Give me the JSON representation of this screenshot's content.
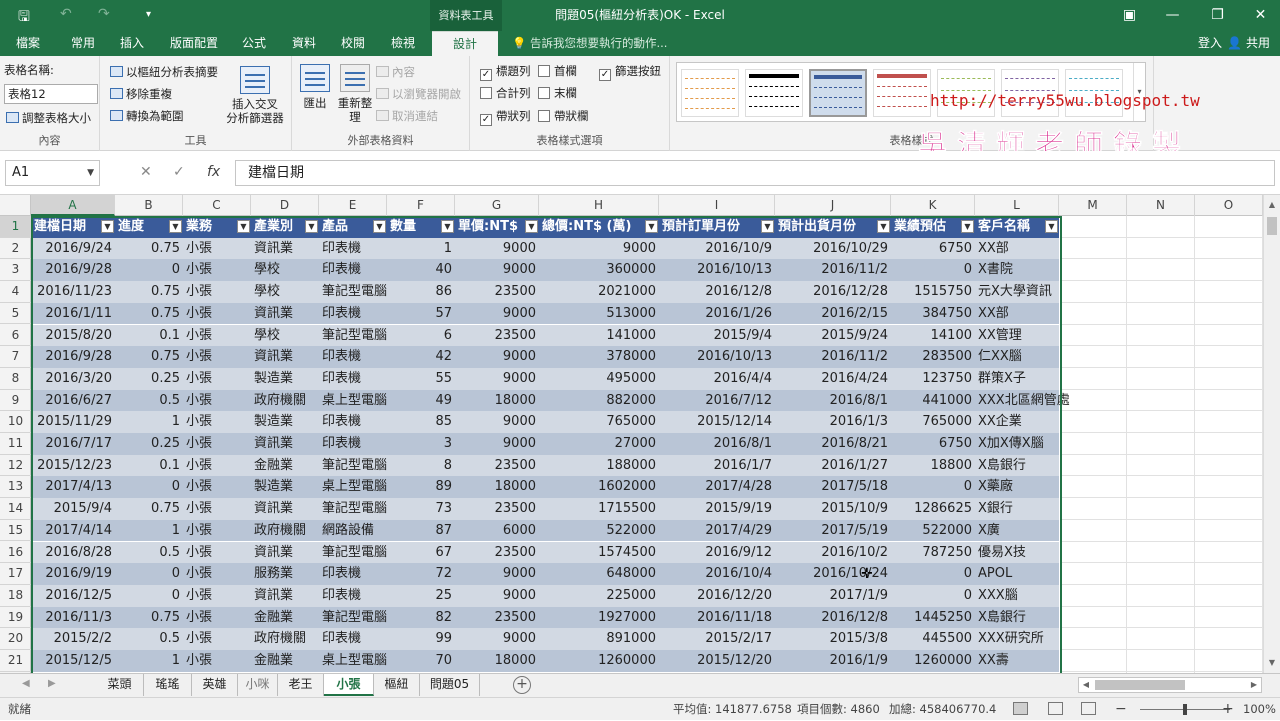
{
  "titlebar": {
    "context_tab": "資料表工具",
    "doc_title": "問題05(樞紐分析表)OK - Excel"
  },
  "tabs": [
    "檔案",
    "常用",
    "插入",
    "版面配置",
    "公式",
    "資料",
    "校閱",
    "檢視",
    "設計"
  ],
  "tell_me": "告訴我您想要執行的動作...",
  "sign_in": "登入",
  "share": "共用",
  "ribbon": {
    "props": {
      "label": "表格名稱:",
      "name": "表格12",
      "resize": "調整表格大小",
      "group": "內容"
    },
    "tools": {
      "pivot": "以樞紐分析表摘要",
      "dedupe": "移除重複",
      "to_range": "轉換為範圍",
      "slicer_line1": "插入交叉",
      "slicer_line2": "分析篩選器",
      "group": "工具"
    },
    "external": {
      "export": "匯出",
      "refresh_line1": "重新整",
      "refresh_line2": "理",
      "properties": "內容",
      "open_browser": "以瀏覽器開啟",
      "unlink": "取消連結",
      "group": "外部表格資料"
    },
    "options": {
      "header_row": "標題列",
      "first_col": "首欄",
      "filter_btn": "篩選按鈕",
      "total_row": "合計列",
      "last_col": "末欄",
      "banded_rows": "帶狀列",
      "banded_cols": "帶狀欄",
      "group": "表格樣式選項"
    },
    "styles_group": "表格樣式"
  },
  "watermark": {
    "url": "http://terry55wu.blogspot.tw",
    "title": "吳清輝老師錄製"
  },
  "formula_bar": {
    "name_box": "A1",
    "cancel": "✕",
    "enter": "✓",
    "fx": "fx",
    "content": "建檔日期"
  },
  "columns": [
    "A",
    "B",
    "C",
    "D",
    "E",
    "F",
    "G",
    "H",
    "I",
    "J",
    "K",
    "L",
    "M",
    "N",
    "O"
  ],
  "row_numbers": [
    "1",
    "2",
    "3",
    "4",
    "5",
    "6",
    "7",
    "8",
    "9",
    "10",
    "11",
    "12",
    "13",
    "14",
    "15",
    "16",
    "17",
    "18",
    "19",
    "20",
    "21"
  ],
  "table": {
    "headers": [
      "建檔日期",
      "進度",
      "業務",
      "產業別",
      "產品",
      "數量",
      "單價:NT$",
      "總價:NT$ (萬)",
      "預計訂單月份",
      "預計出貨月份",
      "業績預估",
      "客戶名稱"
    ],
    "rows": [
      [
        "2016/9/24",
        "0.75",
        "小張",
        "資訊業",
        "印表機",
        "1",
        "9000",
        "9000",
        "2016/10/9",
        "2016/10/29",
        "6750",
        "XX部"
      ],
      [
        "2016/9/28",
        "0",
        "小張",
        "學校",
        "印表機",
        "40",
        "9000",
        "360000",
        "2016/10/13",
        "2016/11/2",
        "0",
        "X書院"
      ],
      [
        "2016/11/23",
        "0.75",
        "小張",
        "學校",
        "筆記型電腦",
        "86",
        "23500",
        "2021000",
        "2016/12/8",
        "2016/12/28",
        "1515750",
        "元X大學資訊"
      ],
      [
        "2016/1/11",
        "0.75",
        "小張",
        "資訊業",
        "印表機",
        "57",
        "9000",
        "513000",
        "2016/1/26",
        "2016/2/15",
        "384750",
        "XX部"
      ],
      [
        "2015/8/20",
        "0.1",
        "小張",
        "學校",
        "筆記型電腦",
        "6",
        "23500",
        "141000",
        "2015/9/4",
        "2015/9/24",
        "14100",
        "XX管理"
      ],
      [
        "2016/9/28",
        "0.75",
        "小張",
        "資訊業",
        "印表機",
        "42",
        "9000",
        "378000",
        "2016/10/13",
        "2016/11/2",
        "283500",
        "仁XX腦"
      ],
      [
        "2016/3/20",
        "0.25",
        "小張",
        "製造業",
        "印表機",
        "55",
        "9000",
        "495000",
        "2016/4/4",
        "2016/4/24",
        "123750",
        "群策X子"
      ],
      [
        "2016/6/27",
        "0.5",
        "小張",
        "政府機關",
        "桌上型電腦",
        "49",
        "18000",
        "882000",
        "2016/7/12",
        "2016/8/1",
        "441000",
        "XXX北區網管處"
      ],
      [
        "2015/11/29",
        "1",
        "小張",
        "製造業",
        "印表機",
        "85",
        "9000",
        "765000",
        "2015/12/14",
        "2016/1/3",
        "765000",
        "XX企業"
      ],
      [
        "2016/7/17",
        "0.25",
        "小張",
        "資訊業",
        "印表機",
        "3",
        "9000",
        "27000",
        "2016/8/1",
        "2016/8/21",
        "6750",
        "X加X傳X腦"
      ],
      [
        "2015/12/23",
        "0.1",
        "小張",
        "金融業",
        "筆記型電腦",
        "8",
        "23500",
        "188000",
        "2016/1/7",
        "2016/1/27",
        "18800",
        "X島銀行"
      ],
      [
        "2017/4/13",
        "0",
        "小張",
        "製造業",
        "桌上型電腦",
        "89",
        "18000",
        "1602000",
        "2017/4/28",
        "2017/5/18",
        "0",
        "X藥廠"
      ],
      [
        "2015/9/4",
        "0.75",
        "小張",
        "資訊業",
        "筆記型電腦",
        "73",
        "23500",
        "1715500",
        "2015/9/19",
        "2015/10/9",
        "1286625",
        "X銀行"
      ],
      [
        "2017/4/14",
        "1",
        "小張",
        "政府機關",
        "網路設備",
        "87",
        "6000",
        "522000",
        "2017/4/29",
        "2017/5/19",
        "522000",
        "X廣"
      ],
      [
        "2016/8/28",
        "0.5",
        "小張",
        "資訊業",
        "筆記型電腦",
        "67",
        "23500",
        "1574500",
        "2016/9/12",
        "2016/10/2",
        "787250",
        "優易X技"
      ],
      [
        "2016/9/19",
        "0",
        "小張",
        "服務業",
        "印表機",
        "72",
        "9000",
        "648000",
        "2016/10/4",
        "2016/10/24",
        "0",
        "APOL"
      ],
      [
        "2016/12/5",
        "0",
        "小張",
        "資訊業",
        "印表機",
        "25",
        "9000",
        "225000",
        "2016/12/20",
        "2017/1/9",
        "0",
        "XXX腦"
      ],
      [
        "2016/11/3",
        "0.75",
        "小張",
        "金融業",
        "筆記型電腦",
        "82",
        "23500",
        "1927000",
        "2016/11/18",
        "2016/12/8",
        "1445250",
        "X島銀行"
      ],
      [
        "2015/2/2",
        "0.5",
        "小張",
        "政府機關",
        "印表機",
        "99",
        "9000",
        "891000",
        "2015/2/17",
        "2015/3/8",
        "445500",
        "XXX研究所"
      ],
      [
        "2015/12/5",
        "1",
        "小張",
        "金融業",
        "桌上型電腦",
        "70",
        "18000",
        "1260000",
        "2015/12/20",
        "2016/1/9",
        "1260000",
        "XX壽"
      ]
    ]
  },
  "sheet_tabs": [
    "菜頭",
    "瑤瑤",
    "英雄",
    "小咪",
    "老王",
    "小張",
    "樞紐",
    "問題05"
  ],
  "active_sheet_index": 5,
  "status": {
    "ready": "就緒",
    "average": "平均值: 141877.6758",
    "count": "項目個數: 4860",
    "sum": "加總: 458406770.4",
    "zoom": "100%"
  },
  "colors": {
    "accent": "#217346",
    "table_header": "#3a5b9a",
    "band_a": "#d2d9e3",
    "band_b": "#b9c5d6"
  }
}
